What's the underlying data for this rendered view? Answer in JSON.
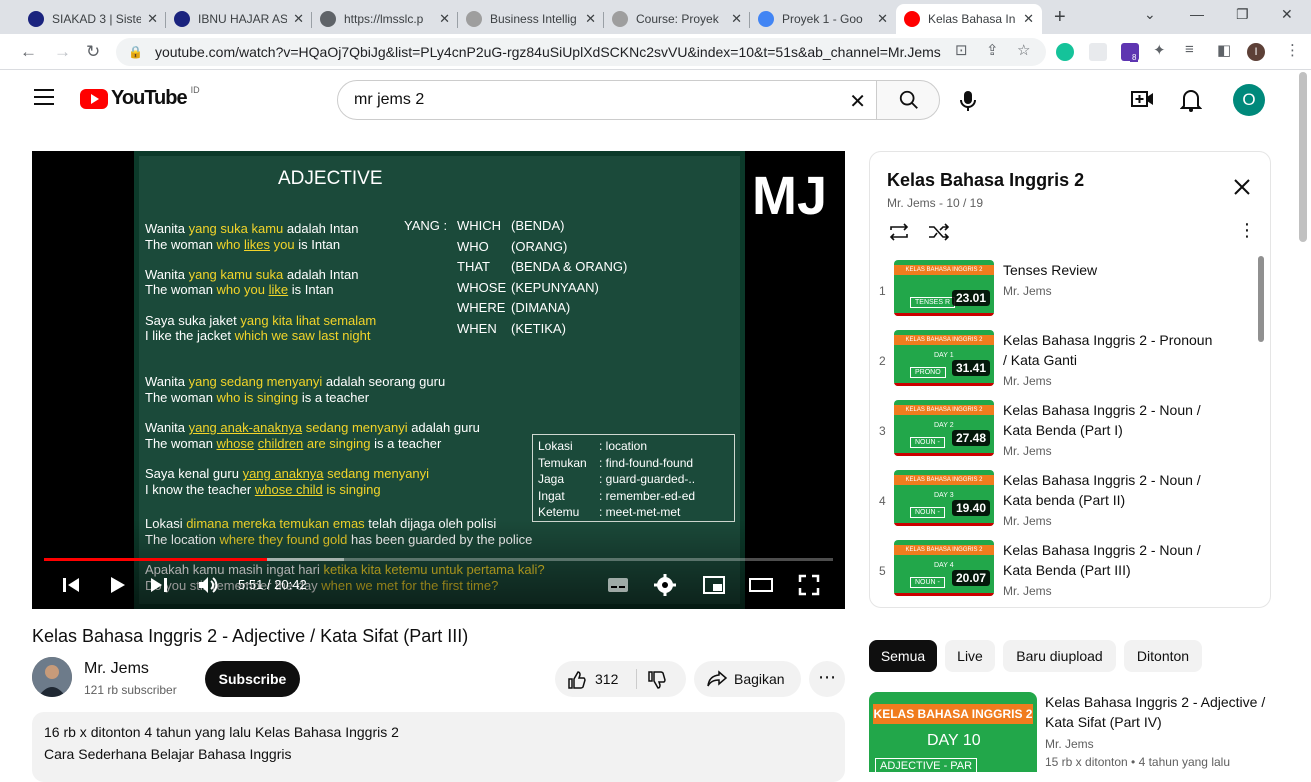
{
  "browser": {
    "tabs": [
      {
        "title": "SIAKAD 3 | Siste",
        "favicon_color": "#1a237e"
      },
      {
        "title": "IBNU HAJAR AS",
        "favicon_color": "#1a237e"
      },
      {
        "title": "https://lmsslc.p",
        "favicon_color": "#5f6368"
      },
      {
        "title": "Business Intellig",
        "favicon_color": "#9e9e9e"
      },
      {
        "title": "Course: Proyek",
        "favicon_color": "#9e9e9e"
      },
      {
        "title": "Proyek 1 - Goo",
        "favicon_color": "#4285f4"
      },
      {
        "title": "Kelas Bahasa In",
        "favicon_color": "#ff0000"
      }
    ],
    "url": "youtube.com/watch?v=HQaOj7QbiJg&list=PLy4cnP2uG-rgz84uSiUplXdSCKNc2svVU&index=10&t=51s&ab_channel=Mr.Jems",
    "profile_initial": "I",
    "extension_badge": "8"
  },
  "youtube": {
    "logo_text": "YouTube",
    "country": "ID",
    "search_query": "mr jems 2",
    "avatar_initial": "O"
  },
  "video": {
    "slide_title": "ADJECTIVE",
    "watermark": "MJ",
    "lines": [
      {
        "parts": [
          {
            "t": "Wanita ",
            "s": ""
          },
          {
            "t": "yang suka kamu",
            "s": "y"
          },
          {
            "t": " adalah Intan",
            "s": ""
          }
        ]
      },
      {
        "parts": [
          {
            "t": "The woman ",
            "s": ""
          },
          {
            "t": "who ",
            "s": "y"
          },
          {
            "t": "likes",
            "s": "u"
          },
          {
            "t": " you",
            "s": "y"
          },
          {
            "t": " is  Intan",
            "s": ""
          }
        ]
      },
      {
        "parts": [
          {
            "t": "Wanita ",
            "s": ""
          },
          {
            "t": "yang kamu suka",
            "s": "y"
          },
          {
            "t": " adalah Intan",
            "s": ""
          }
        ]
      },
      {
        "parts": [
          {
            "t": "The woman ",
            "s": ""
          },
          {
            "t": "who you ",
            "s": "y"
          },
          {
            "t": "like",
            "s": "u"
          },
          {
            "t": "  is  Intan",
            "s": ""
          }
        ]
      },
      {
        "parts": [
          {
            "t": "Saya suka jaket ",
            "s": ""
          },
          {
            "t": "yang kita lihat semalam",
            "s": "y"
          }
        ]
      },
      {
        "parts": [
          {
            "t": " I  like  the jacket ",
            "s": ""
          },
          {
            "t": "which we  saw  last night",
            "s": "y"
          }
        ]
      },
      {
        "parts": [
          {
            "t": "Wanita ",
            "s": ""
          },
          {
            "t": "yang sedang menyanyi",
            "s": "y"
          },
          {
            "t": " adalah seorang guru",
            "s": ""
          }
        ]
      },
      {
        "parts": [
          {
            "t": "The woman ",
            "s": ""
          },
          {
            "t": "who is singing",
            "s": "y"
          },
          {
            "t": "  is  a  teacher",
            "s": ""
          }
        ]
      },
      {
        "parts": [
          {
            "t": "Wanita  ",
            "s": ""
          },
          {
            "t": "yang anak-anaknya",
            "s": "u"
          },
          {
            "t": "  sedang menyanyi",
            "s": "y"
          },
          {
            "t": " adalah guru",
            "s": ""
          }
        ]
      },
      {
        "parts": [
          {
            "t": "The woman ",
            "s": ""
          },
          {
            "t": "whose",
            "s": "u"
          },
          {
            "t": "  ",
            "s": ""
          },
          {
            "t": "children",
            "s": "u"
          },
          {
            "t": "  are singing",
            "s": "y"
          },
          {
            "t": "  is  a   teacher",
            "s": ""
          }
        ]
      },
      {
        "parts": [
          {
            "t": "Saya kenal guru ",
            "s": ""
          },
          {
            "t": "yang anaknya",
            "s": "u"
          },
          {
            "t": "  sedang menyanyi",
            "s": "y"
          }
        ]
      },
      {
        "parts": [
          {
            "t": "  I  know  the teacher ",
            "s": ""
          },
          {
            "t": "whose child",
            "s": "u"
          },
          {
            "t": "  is  singing",
            "s": "y"
          }
        ]
      },
      {
        "parts": [
          {
            "t": "Lokasi ",
            "s": ""
          },
          {
            "t": "dimana  mereka temukan emas",
            "s": "y"
          },
          {
            "t": " telah dijaga oleh polisi",
            "s": ""
          }
        ]
      },
      {
        "parts": [
          {
            "t": "The location  ",
            "s": ""
          },
          {
            "t": "where they  found  gold",
            "s": "y"
          },
          {
            "t": "  has   been   guarded  by the police",
            "s": ""
          }
        ]
      },
      {
        "parts": [
          {
            "t": "Apakah kamu masih ingat hari  ",
            "s": ""
          },
          {
            "t": "ketika kita ketemu untuk pertama kali?",
            "s": "y"
          }
        ]
      },
      {
        "parts": [
          {
            "t": "Do  you  still  remember  the day  ",
            "s": ""
          },
          {
            "t": "when we  met  for the first time?",
            "s": "y"
          }
        ]
      }
    ],
    "yang": {
      "label": "YANG :",
      "items": [
        {
          "word": "WHICH",
          "meaning": "(BENDA)"
        },
        {
          "word": "WHO",
          "meaning": "(ORANG)"
        },
        {
          "word": "THAT",
          "meaning": "(BENDA & ORANG)"
        },
        {
          "word": "WHOSE",
          "meaning": "(KEPUNYAAN)"
        },
        {
          "word": "WHERE",
          "meaning": "(DIMANA)"
        },
        {
          "word": "WHEN",
          "meaning": "(KETIKA)"
        }
      ]
    },
    "vocab": [
      {
        "k": "Lokasi",
        "v": ": location"
      },
      {
        "k": "Temukan",
        "v": ": find-found-found"
      },
      {
        "k": "Jaga",
        "v": ": guard-guarded-.."
      },
      {
        "k": "Ingat",
        "v": ": remember-ed-ed"
      },
      {
        "k": "Ketemu",
        "v": ": meet-met-met"
      }
    ],
    "current_time": "5:51",
    "duration": "20:42",
    "played_fraction": 0.283,
    "buffered_fraction": 0.38,
    "title": "Kelas Bahasa Inggris 2 - Adjective / Kata Sifat (Part III)",
    "channel": "Mr. Jems",
    "subscribers": "121 rb subscriber",
    "subscribe_label": "Subscribe",
    "likes": "312",
    "share_label": "Bagikan",
    "views": "16 rb x ditonton",
    "age": "4 tahun yang lalu",
    "playlist_tag": "Kelas Bahasa Inggris 2",
    "description": "Cara Sederhana Belajar Bahasa Inggris"
  },
  "playlist": {
    "title": "Kelas Bahasa Inggris 2",
    "subtitle": "Mr. Jems - 10 / 19",
    "items": [
      {
        "index": "1",
        "title": "Tenses Review",
        "channel": "Mr. Jems",
        "duration": "23.01",
        "day": "",
        "tag": "TENSES R"
      },
      {
        "index": "2",
        "title": "Kelas Bahasa Inggris 2 - Pronoun / Kata Ganti",
        "channel": "Mr. Jems",
        "duration": "31.41",
        "day": "DAY 1",
        "tag": "PRONO"
      },
      {
        "index": "3",
        "title": "Kelas Bahasa Inggris 2 - Noun / Kata Benda (Part I)",
        "channel": "Mr. Jems",
        "duration": "27.48",
        "day": "DAY 2",
        "tag": "NOUN -"
      },
      {
        "index": "4",
        "title": "Kelas Bahasa Inggris 2 - Noun / Kata benda (Part II)",
        "channel": "Mr. Jems",
        "duration": "19.40",
        "day": "DAY 3",
        "tag": "NOUN -"
      },
      {
        "index": "5",
        "title": "Kelas Bahasa Inggris 2 - Noun / Kata Benda (Part III)",
        "channel": "Mr. Jems",
        "duration": "20.07",
        "day": "DAY 4",
        "tag": "NOUN -"
      }
    ],
    "thumb_band": "KELAS BAHASA INGGRIS 2"
  },
  "chips": [
    "Semua",
    "Live",
    "Baru diupload",
    "Ditonton"
  ],
  "recommendation": {
    "title": "Kelas Bahasa Inggris 2 - Adjective / Kata Sifat (Part IV)",
    "channel": "Mr. Jems",
    "meta": "15 rb x ditonton  • 4 tahun yang lalu",
    "thumb_band": "KELAS BAHASA INGGRIS 2",
    "thumb_day": "DAY 10",
    "thumb_sub": "ADJECTIVE - PAR"
  },
  "colors": {
    "youtube_red": "#ff0000",
    "slide_green": "#1b4a3a",
    "highlight_yellow": "#f2d42a",
    "thumb_green": "#22a74a",
    "thumb_orange": "#f07c1e"
  }
}
